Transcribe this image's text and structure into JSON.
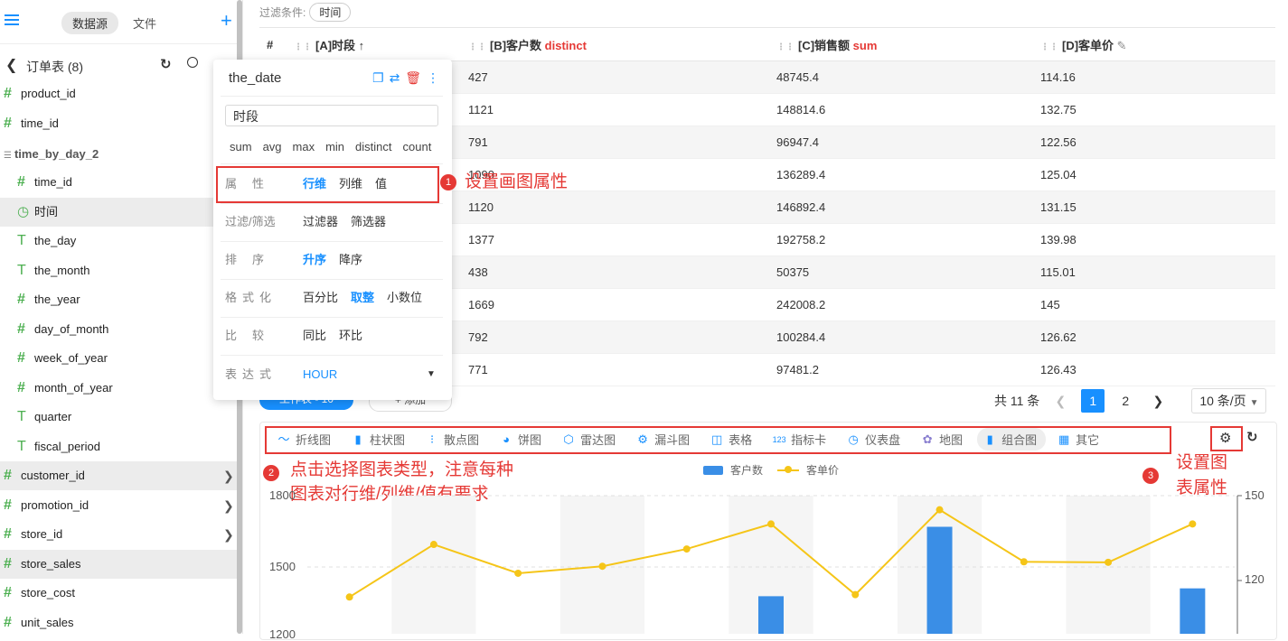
{
  "sidebar": {
    "tabs": [
      "数据源",
      "文件"
    ],
    "table_name": "订单表 (8)",
    "fields_top": [
      "product_id",
      "time_id"
    ],
    "group_name": "time_by_day_2",
    "group_fields": [
      {
        "icon": "#",
        "label": "time_id"
      },
      {
        "icon": "clock",
        "label": "时间"
      },
      {
        "icon": "T",
        "label": "the_day"
      },
      {
        "icon": "T",
        "label": "the_month"
      },
      {
        "icon": "#",
        "label": "the_year"
      },
      {
        "icon": "#",
        "label": "day_of_month"
      },
      {
        "icon": "#",
        "label": "week_of_year"
      },
      {
        "icon": "#",
        "label": "month_of_year"
      },
      {
        "icon": "T",
        "label": "quarter"
      },
      {
        "icon": "T",
        "label": "fiscal_period"
      }
    ],
    "fields_bottom": [
      "customer_id",
      "promotion_id",
      "store_id",
      "store_sales",
      "store_cost",
      "unit_sales"
    ]
  },
  "filter": {
    "label": "过滤条件:",
    "chip": "时间"
  },
  "table": {
    "headers": {
      "index": "#",
      "a": "[A]时段",
      "a_sort": "↑",
      "b": "[B]客户数",
      "b_agg": "distinct",
      "c": "[C]销售额",
      "c_agg": "sum",
      "d": "[D]客单价"
    },
    "rows": [
      [
        "427",
        "48745.4",
        "114.16"
      ],
      [
        "1121",
        "148814.6",
        "132.75"
      ],
      [
        "791",
        "96947.4",
        "122.56"
      ],
      [
        "1090",
        "136289.4",
        "125.04"
      ],
      [
        "1120",
        "146892.4",
        "131.15"
      ],
      [
        "1377",
        "192758.2",
        "139.98"
      ],
      [
        "438",
        "50375",
        "115.01"
      ],
      [
        "1669",
        "242008.2",
        "145"
      ],
      [
        "792",
        "100284.4",
        "126.62"
      ],
      [
        "771",
        "97481.2",
        "126.43"
      ]
    ]
  },
  "pagination": {
    "total": "共 11 条",
    "pages": [
      "1",
      "2"
    ],
    "page_size": "10 条/页"
  },
  "worktable": {
    "button": "工作表 - 10",
    "add": "+ 添加"
  },
  "popup": {
    "title": "the_date",
    "alias": "时段",
    "aggs": [
      "sum",
      "avg",
      "max",
      "min",
      "distinct",
      "count"
    ],
    "rows": {
      "attr": {
        "key": "属　性",
        "opts": [
          "行维",
          "列维",
          "值"
        ],
        "on": 0
      },
      "filter": {
        "key": "过滤/筛选",
        "opts": [
          "过滤器",
          "筛选器"
        ],
        "on": -1
      },
      "sort": {
        "key": "排　序",
        "opts": [
          "升序",
          "降序"
        ],
        "on": 0
      },
      "format": {
        "key": "格式化",
        "opts": [
          "百分比",
          "取整",
          "小数位"
        ],
        "on": 1
      },
      "compare": {
        "key": "比　较",
        "opts": [
          "同比",
          "环比"
        ],
        "on": -1
      },
      "expr": {
        "key": "表达式",
        "value": "HOUR"
      }
    }
  },
  "annotations": {
    "a1": "设置画图属性",
    "a2_line1": "点击选择图表类型，注意每种",
    "a2_line2": "图表对行维/列维/值有要求",
    "a3_line1": "设置图",
    "a3_line2": "表属性",
    "n1": "1",
    "n2": "2",
    "n3": "3"
  },
  "chart_tabs": [
    {
      "icon": "line-chart-icon",
      "label": "折线图"
    },
    {
      "icon": "bar-chart-icon",
      "label": "柱状图"
    },
    {
      "icon": "scatter-icon",
      "label": "散点图"
    },
    {
      "icon": "pie-icon",
      "label": "饼图"
    },
    {
      "icon": "radar-icon",
      "label": "雷达图"
    },
    {
      "icon": "funnel-icon",
      "label": "漏斗图"
    },
    {
      "icon": "table-icon",
      "label": "表格"
    },
    {
      "icon": "kpi-icon",
      "label": "指标卡"
    },
    {
      "icon": "gauge-icon",
      "label": "仪表盘"
    },
    {
      "icon": "map-icon",
      "label": "地图"
    },
    {
      "icon": "combo-icon",
      "label": "组合图"
    },
    {
      "icon": "other-icon",
      "label": "其它"
    }
  ],
  "chart_data": {
    "type": "bar",
    "legend": [
      "客户数",
      "客单价"
    ],
    "series": [
      {
        "name": "客户数",
        "type": "bar",
        "values": [
          427,
          1121,
          791,
          1090,
          1120,
          1377,
          438,
          1669,
          792,
          771,
          1410
        ]
      },
      {
        "name": "客单价",
        "type": "line",
        "values": [
          114.16,
          132.75,
          122.56,
          125.04,
          131.15,
          139.98,
          115.01,
          145,
          126.62,
          126.43,
          140
        ]
      }
    ],
    "y_left_ticks": [
      "1800",
      "1500",
      "1200"
    ],
    "y_right_ticks": [
      "150",
      "120"
    ],
    "ylim_left": [
      1200,
      1800
    ],
    "ylim_right": [
      100,
      150
    ],
    "colors": {
      "bar": "#3a8ee6",
      "line": "#f5c518"
    }
  }
}
